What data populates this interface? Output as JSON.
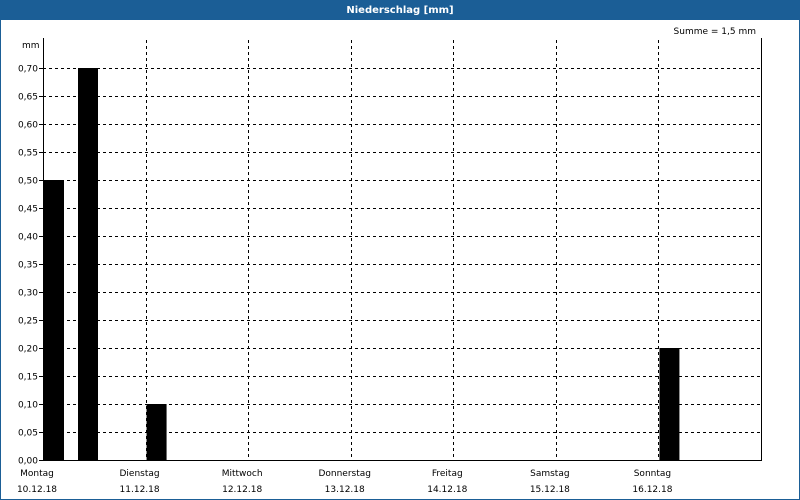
{
  "window": {
    "title": "Niederschlag [mm]"
  },
  "colors": {
    "title_bar": "#1b5e96",
    "bar": "#000000",
    "grid": "#000000"
  },
  "chart_data": {
    "type": "bar",
    "title": "Niederschlag [mm]",
    "summary": "Summe = 1,5 mm",
    "ylabel": "mm",
    "ylim": [
      0,
      0.75
    ],
    "yticks": [
      "0,00",
      "0,05",
      "0,10",
      "0,15",
      "0,20",
      "0,25",
      "0,30",
      "0,35",
      "0,40",
      "0,45",
      "0,50",
      "0,55",
      "0,60",
      "0,65",
      "0,70"
    ],
    "ytick_values": [
      0,
      0.05,
      0.1,
      0.15,
      0.2,
      0.25,
      0.3,
      0.35,
      0.4,
      0.45,
      0.5,
      0.55,
      0.6,
      0.65,
      0.7
    ],
    "grid": true,
    "days": [
      {
        "weekday": "Montag",
        "date": "10.12.18"
      },
      {
        "weekday": "Dienstag",
        "date": "11.12.18"
      },
      {
        "weekday": "Mittwoch",
        "date": "12.12.18"
      },
      {
        "weekday": "Donnerstag",
        "date": "13.12.18"
      },
      {
        "weekday": "Freitag",
        "date": "14.12.18"
      },
      {
        "weekday": "Samstag",
        "date": "15.12.18"
      },
      {
        "weekday": "Sonntag",
        "date": "16.12.18"
      }
    ],
    "bars": [
      {
        "day_index": 0,
        "slot": 0,
        "value": 0.5
      },
      {
        "day_index": 0,
        "slot": 1,
        "value": 0.7
      },
      {
        "day_index": 1,
        "slot": 0,
        "value": 0.1
      },
      {
        "day_index": 6,
        "slot": 0,
        "value": 0.2
      }
    ]
  }
}
